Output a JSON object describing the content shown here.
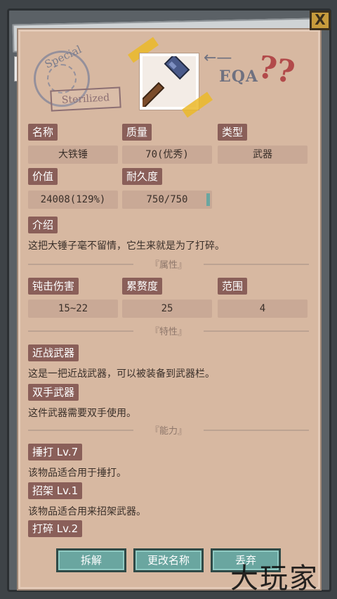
{
  "header": {
    "stamp_text": "Special",
    "sterilized": "Sterilized",
    "eqa": "EQA",
    "qmarks": "??",
    "arrow": "←—",
    "close_label": "X"
  },
  "info": {
    "name_label": "名称",
    "name_value": "大铁锤",
    "quality_label": "质量",
    "quality_value": "70(优秀)",
    "type_label": "类型",
    "type_value": "武器",
    "value_label": "价值",
    "value_value": "24008(129%)",
    "durability_label": "耐久度",
    "durability_value": "750/750",
    "durability_fraction": 1.0
  },
  "intro": {
    "label": "介绍",
    "text": "这把大锤子毫不留情，它生来就是为了打碎。"
  },
  "attributes": {
    "title": "『属性』",
    "blunt_label": "钝击伤害",
    "blunt_value": "15~22",
    "stamina_label": "累赘度",
    "stamina_value": "25",
    "range_label": "范围",
    "range_value": "4"
  },
  "traits": {
    "title": "『特性』",
    "items": [
      {
        "label": "近战武器",
        "text": "这是一把近战武器，可以被装备到武器栏。"
      },
      {
        "label": "双手武器",
        "text": "这件武器需要双手使用。"
      }
    ]
  },
  "abilities": {
    "title": "『能力』",
    "items": [
      {
        "label": "捶打 Lv.7",
        "text": "该物品适合用于捶打。"
      },
      {
        "label": "招架 Lv.1",
        "text": "该物品适合用来招架武器。"
      },
      {
        "label": "打碎 Lv.2",
        "text": ""
      }
    ]
  },
  "actions": {
    "dismantle": "拆解",
    "rename": "更改名称",
    "discard": "丢弃"
  },
  "watermark": "大玩家",
  "colors": {
    "paper": "#d7b8a1",
    "tag": "#8a5f59",
    "field": "#c9a996",
    "button": "#6aa6a0",
    "close": "#c79b3c"
  }
}
